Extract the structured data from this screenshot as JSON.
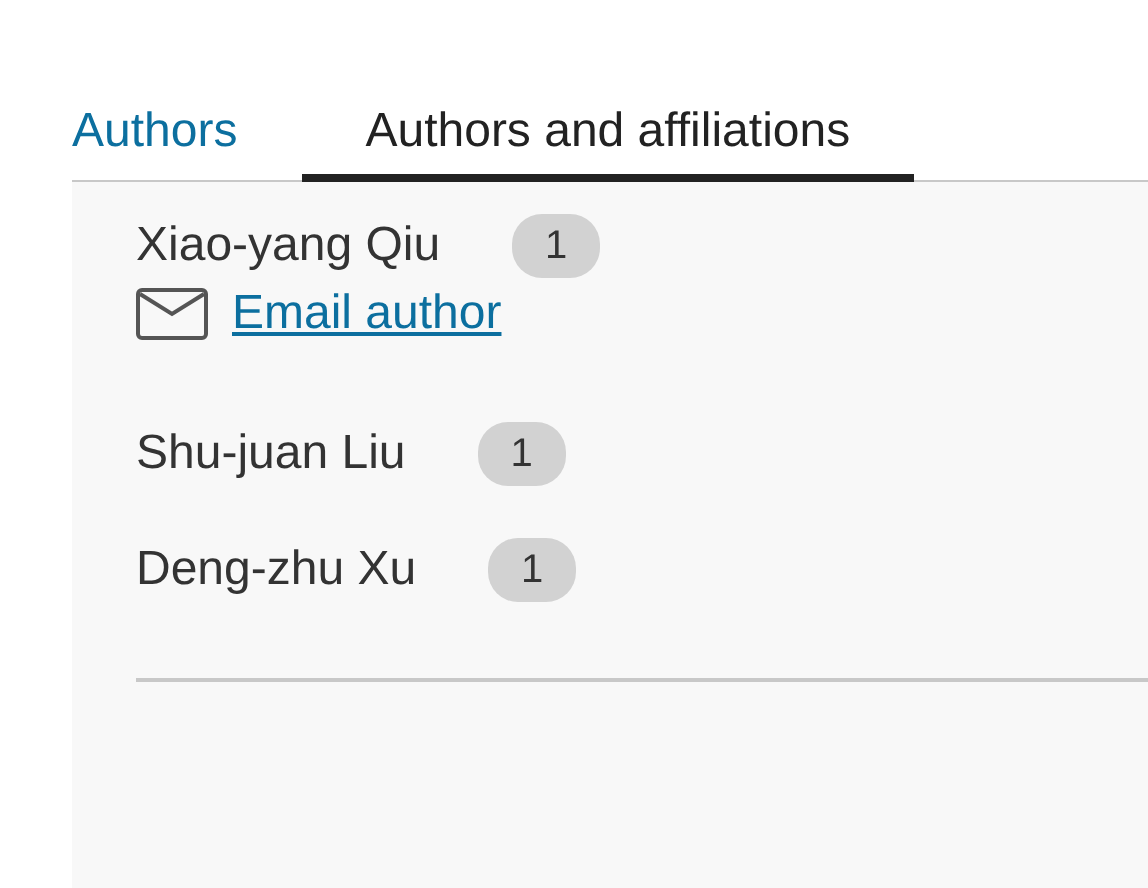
{
  "tabs": [
    {
      "label": "Authors",
      "selected": false
    },
    {
      "label": "Authors and affiliations",
      "selected": true
    }
  ],
  "authors": [
    {
      "name": "Xiao-yang Qiu",
      "badge": "1",
      "email_link": "Email author"
    },
    {
      "name": "Shu-juan Liu",
      "badge": "1"
    },
    {
      "name": "Deng-zhu Xu",
      "badge": "1"
    }
  ]
}
